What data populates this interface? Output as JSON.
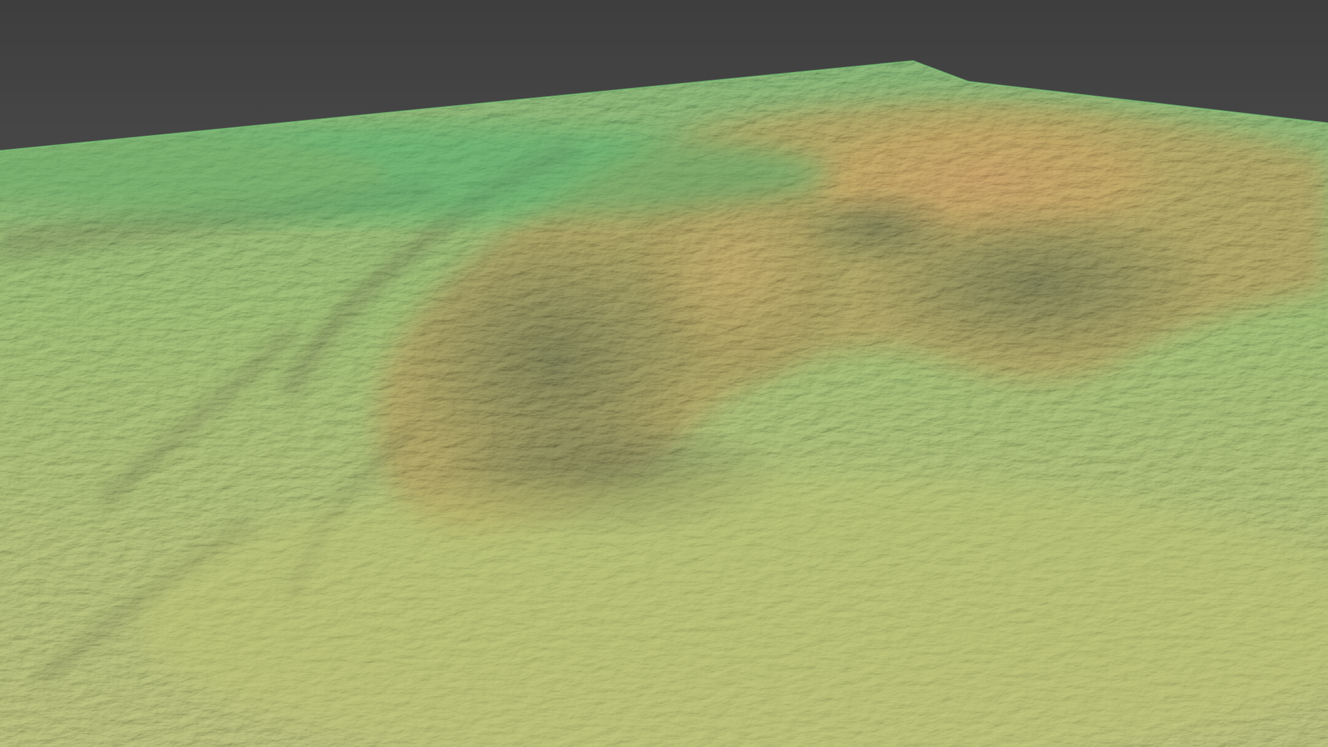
{
  "scene": {
    "subject": "terrain-relief-render",
    "colors": {
      "sky_top": "#3e3e3e",
      "sky_bottom": "#6a6a6a",
      "lowland_green": "#6fbf5c",
      "far_green": "#4fb063",
      "midland_yellow_green": "#b4c86a",
      "slope_ochre": "#b08a3c",
      "summit_orange": "#d98a45",
      "shadow_dark": "#2e3a1c"
    }
  }
}
